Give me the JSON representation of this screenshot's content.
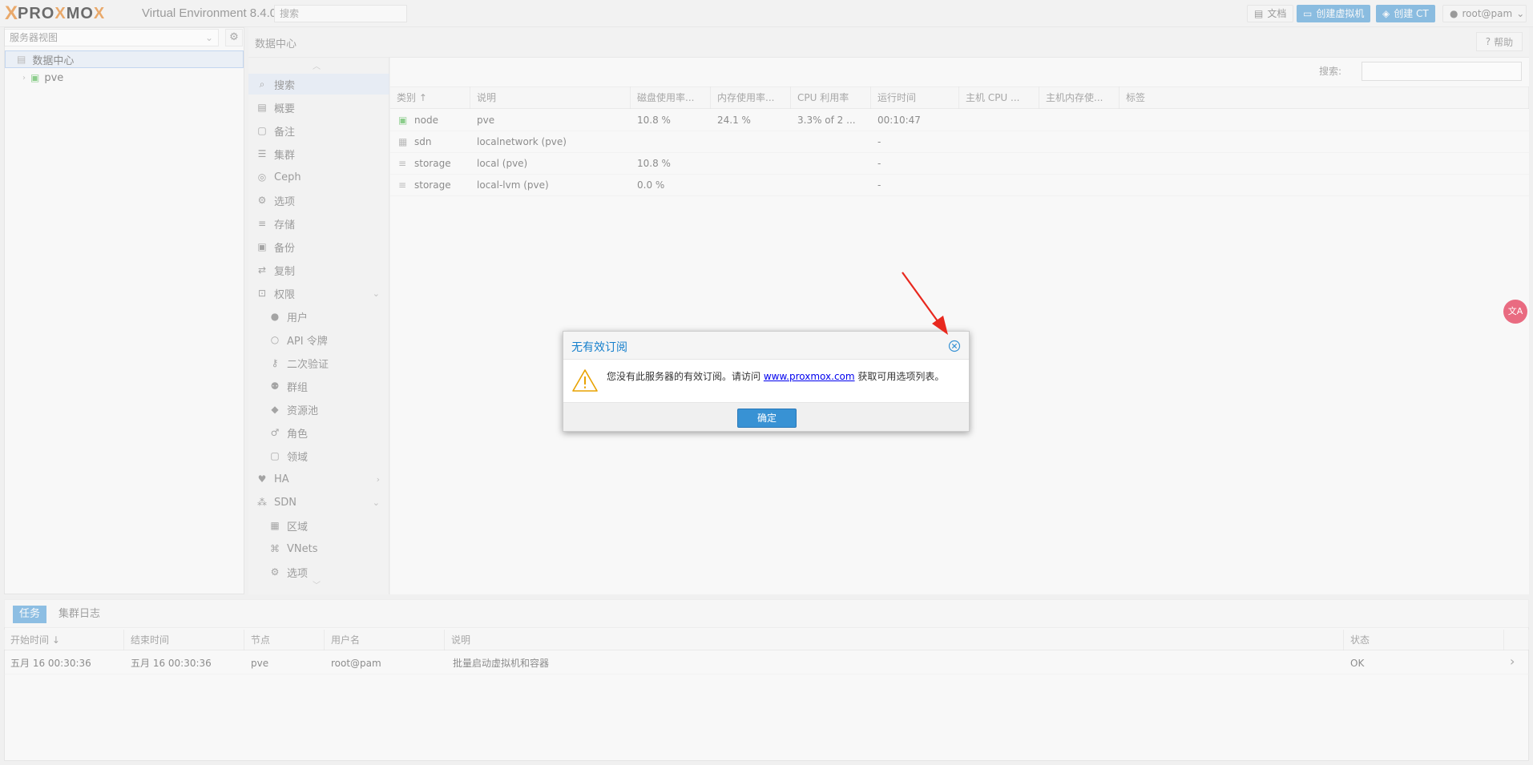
{
  "topbar": {
    "logo_x": "X",
    "logo_word_a": "PRO",
    "logo_word_o": "X",
    "logo_word_b": "MO",
    "logo_word_c": "X",
    "version": "Virtual Environment 8.4.0",
    "search_placeholder": "搜索",
    "docs_label": "文档",
    "create_vm_label": "创建虚拟机",
    "create_ct_label": "创建 CT",
    "user_label": "root@pam"
  },
  "left": {
    "view_select": "服务器视图",
    "tree": [
      {
        "label": "数据中心",
        "selected": true
      },
      {
        "label": "pve",
        "selected": false
      }
    ]
  },
  "header": {
    "breadcrumb": "数据中心",
    "help_label": "帮助"
  },
  "nav": {
    "items": [
      {
        "label": "搜索",
        "icon": "search-icon",
        "selected": true,
        "child": false
      },
      {
        "label": "概要",
        "icon": "book-icon",
        "child": false
      },
      {
        "label": "备注",
        "icon": "note-icon",
        "child": false
      },
      {
        "label": "集群",
        "icon": "server-icon",
        "child": false
      },
      {
        "label": "Ceph",
        "icon": "ceph-icon",
        "child": false
      },
      {
        "label": "选项",
        "icon": "gear-icon",
        "child": false
      },
      {
        "label": "存储",
        "icon": "database-icon",
        "child": false
      },
      {
        "label": "备份",
        "icon": "floppy-icon",
        "child": false
      },
      {
        "label": "复制",
        "icon": "retweet-icon",
        "child": false
      },
      {
        "label": "权限",
        "icon": "unlock-icon",
        "child": false,
        "chevron": "down"
      },
      {
        "label": "用户",
        "icon": "user-icon",
        "child": true
      },
      {
        "label": "API 令牌",
        "icon": "user-outline-icon",
        "child": true
      },
      {
        "label": "二次验证",
        "icon": "key-icon",
        "child": true
      },
      {
        "label": "群组",
        "icon": "users-icon",
        "child": true
      },
      {
        "label": "资源池",
        "icon": "tags-icon",
        "child": true
      },
      {
        "label": "角色",
        "icon": "male-icon",
        "child": true
      },
      {
        "label": "领域",
        "icon": "address-book-icon",
        "child": true
      },
      {
        "label": "HA",
        "icon": "heartbeat-icon",
        "child": false,
        "chevron": "right"
      },
      {
        "label": "SDN",
        "icon": "sdn-icon",
        "child": false,
        "chevron": "down"
      },
      {
        "label": "区域",
        "icon": "th-icon",
        "child": true
      },
      {
        "label": "VNets",
        "icon": "network-icon",
        "child": true
      },
      {
        "label": "选项",
        "icon": "gear-icon",
        "child": true
      }
    ]
  },
  "main": {
    "search_label": "搜索:",
    "columns": [
      "类别 ↑",
      "说明",
      "磁盘使用率...",
      "内存使用率...",
      "CPU 利用率",
      "运行时间",
      "主机 CPU ...",
      "主机内存使...",
      "标签"
    ],
    "rows": [
      {
        "type": "node",
        "icon": "node-icon",
        "desc": "pve",
        "disk": "10.8 %",
        "mem": "24.1 %",
        "cpu": "3.3% of 2 ...",
        "uptime": "00:10:47"
      },
      {
        "type": "sdn",
        "icon": "sdn-grid-icon",
        "desc": "localnetwork (pve)",
        "disk": "",
        "mem": "",
        "cpu": "",
        "uptime": "-"
      },
      {
        "type": "storage",
        "icon": "database-icon",
        "desc": "local (pve)",
        "disk": "10.8 %",
        "mem": "",
        "cpu": "",
        "uptime": "-"
      },
      {
        "type": "storage",
        "icon": "database-icon",
        "desc": "local-lvm (pve)",
        "disk": "0.0 %",
        "mem": "",
        "cpu": "",
        "uptime": "-"
      }
    ]
  },
  "bottom": {
    "tabs": [
      "任务",
      "集群日志"
    ],
    "columns": [
      "开始时间 ↓",
      "结束时间",
      "节点",
      "用户名",
      "说明",
      "状态"
    ],
    "rows": [
      {
        "start": "五月 16 00:30:36",
        "end": "五月 16 00:30:36",
        "node": "pve",
        "user": "root@pam",
        "desc": "批量启动虚拟机和容器",
        "status": "OK"
      }
    ]
  },
  "dialog": {
    "title": "无有效订阅",
    "message_before": "您没有此服务器的有效订阅。请访问",
    "link": "www.proxmox.com",
    "message_after": "获取可用选项列表。",
    "ok_label": "确定"
  },
  "colors": {
    "accent": "#3892d4",
    "brand_orange": "#e57000",
    "arrow": "#e8281e"
  }
}
